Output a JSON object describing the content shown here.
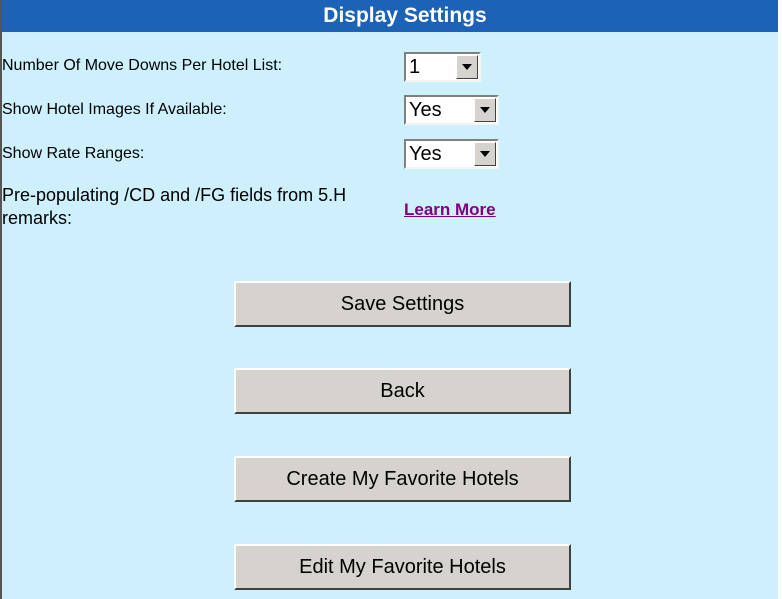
{
  "header": {
    "title": "Display Settings"
  },
  "settings": {
    "move_downs": {
      "label": "Number Of Move Downs Per Hotel List:",
      "value": "1"
    },
    "hotel_images": {
      "label": "Show Hotel Images If Available:",
      "value": "Yes"
    },
    "rate_ranges": {
      "label": "Show Rate Ranges:",
      "value": "Yes"
    },
    "prepopulating": {
      "label": "Pre-populating /CD and /FG fields from 5.H remarks:",
      "link_label": "Learn More"
    }
  },
  "buttons": {
    "save": "Save Settings",
    "back": "Back",
    "create_favorites": "Create My Favorite Hotels",
    "edit_favorites": "Edit My Favorite Hotels"
  },
  "colors": {
    "panel_background": "#cdf0fc",
    "header_background": "#1c63b7",
    "link": "#800080",
    "button_face": "#d6d3ce"
  }
}
